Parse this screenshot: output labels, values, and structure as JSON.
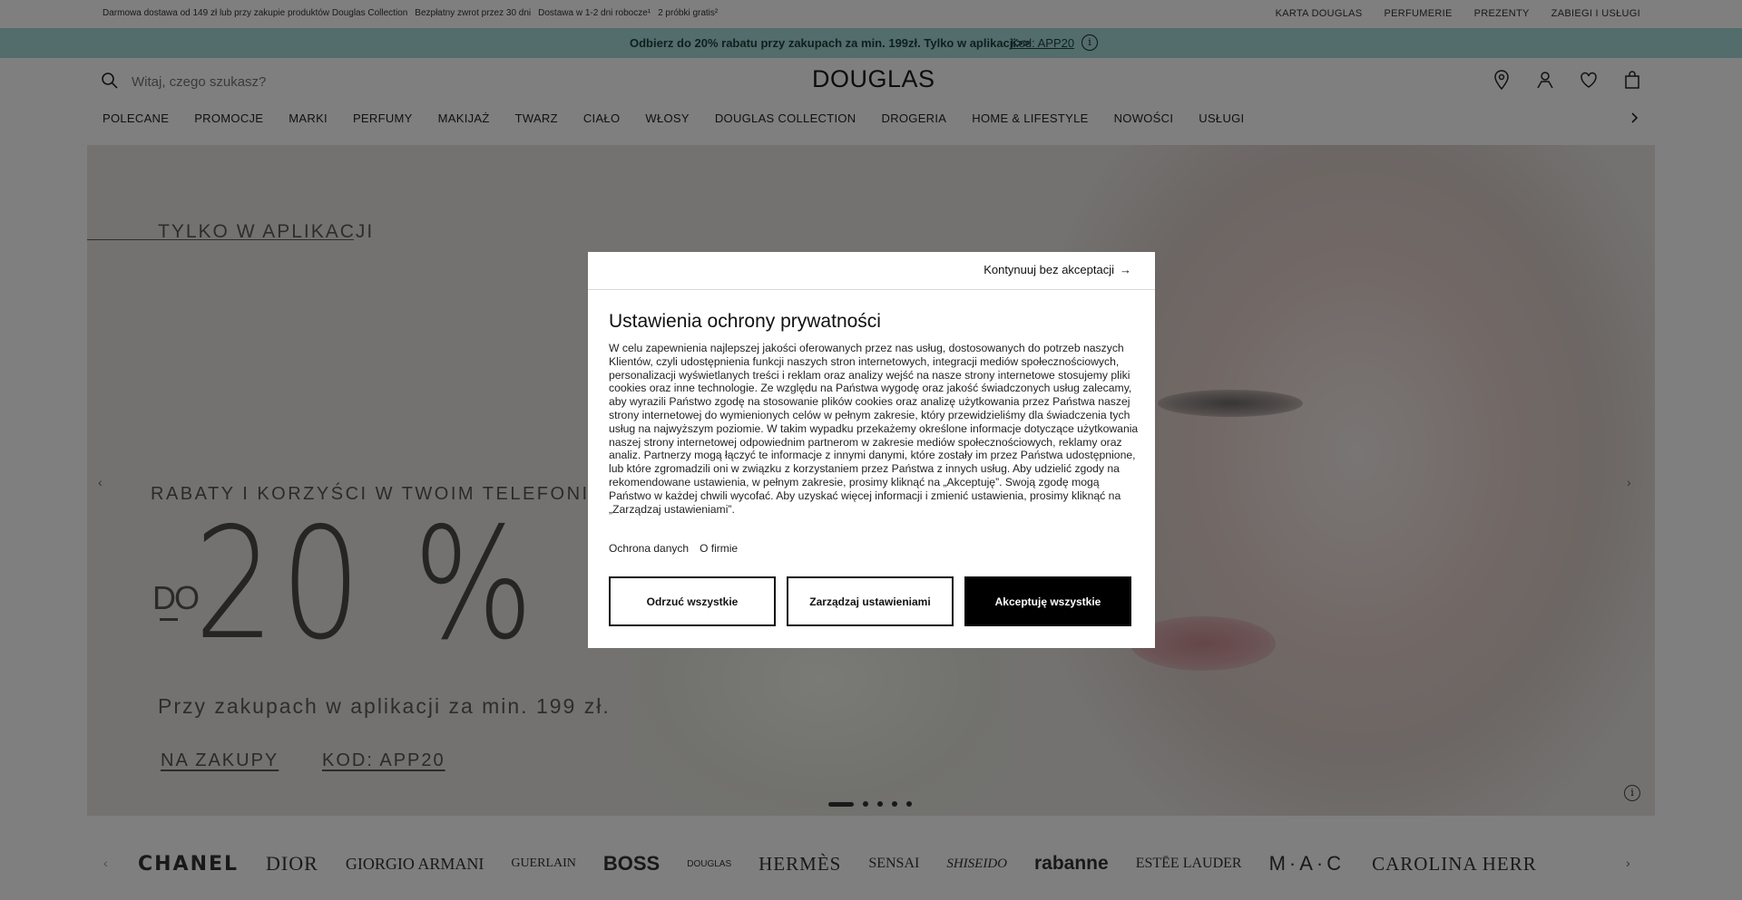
{
  "topbar": {
    "left": [
      "Darmowa dostawa od 149 zł lub przy zakupie produktów Douglas Collection",
      "Bezpłatny zwrot przez 30 dni",
      "Dostawa w 1-2 dni robocze¹",
      "2 próbki gratis²"
    ],
    "right": [
      "KARTA DOUGLAS",
      "PERFUMERIE",
      "PREZENTY",
      "ZABIEGI I USŁUGI"
    ]
  },
  "promo": {
    "message": "Odbierz do 20% rabatu przy zakupach za min. 199zł. Tylko w aplikacji>>",
    "code": "Kod: APP20",
    "info_glyph": "i"
  },
  "header": {
    "search_placeholder": "Witaj, czego szukasz?",
    "logo": "DOUGLAS",
    "icons": [
      "location-icon",
      "account-icon",
      "wishlist-icon",
      "bag-icon"
    ]
  },
  "nav": {
    "items": [
      "POLECANE",
      "PROMOCJE",
      "MARKI",
      "PERFUMY",
      "MAKIJAŻ",
      "TWARZ",
      "CIAŁO",
      "WŁOSY",
      "DOUGLAS COLLECTION",
      "DROGERIA",
      "HOME & LIFESTYLE",
      "NOWOŚCI",
      "USŁUGI"
    ]
  },
  "hero": {
    "only_app": "TYLKO W APLIKACJI",
    "tagline": "RABATY I KORZYŚCI W TWOIM TELEFONIE",
    "do": "DO",
    "percent": "20 %",
    "sub": "Przy zakupach w aplikacji za min. 199 zł.",
    "cta_shop": "NA ZAKUPY",
    "cta_code": "KOD: APP20",
    "arrow_left": "‹",
    "arrow_right": "›",
    "slides": 5,
    "active_slide": 1,
    "info_glyph": "i"
  },
  "brands": {
    "items": [
      "CHANEL",
      "DIOR",
      "GIORGIO ARMANI",
      "GUERLAIN",
      "BOSS",
      "DOUGLAS",
      "HERMÈS",
      "SENSAI",
      "SHISEIDO",
      "rabanne",
      "ESTĒE LAUDER",
      "M·A·C",
      "CAROLINA HERR"
    ],
    "arrow_left": "‹",
    "arrow_right": "›"
  },
  "modal": {
    "continue": "Kontynuuj bez akceptacji",
    "continue_arrow": "→",
    "title": "Ustawienia ochrony prywatności",
    "body": "W celu zapewnienia najlepszej jakości oferowanych przez nas usług, dostosowanych do potrzeb naszych Klientów, czyli udostępnienia funkcji naszych stron internetowych, integracji mediów społecznościowych, personalizacji wyświetlanych treści i reklam oraz analizy wejść na nasze strony internetowe stosujemy pliki cookies oraz inne technologie. Ze względu na Państwa wygodę oraz jakość świadczonych usług zalecamy, aby wyrazili Państwo zgodę na stosowanie plików cookies oraz analizę użytkowania przez Państwa naszej strony internetowej do wymienionych celów w pełnym zakresie, który przewidzieliśmy dla świadczenia tych usług na najwyższym poziomie. W takim wypadku przekażemy określone informacje dotyczące użytkowania naszej strony internetowej odpowiednim partnerom w zakresie mediów społecznościowych, reklamy oraz analiz. Partnerzy mogą łączyć te informacje z innymi danymi, które zostały im przez Państwa udostępnione, lub które zgromadzili oni w związku z korzystaniem przez Państwa z innych usług. Aby udzielić zgody na rekomendowane ustawienia, w pełnym zakresie, prosimy kliknąć na „Akceptuję”. Swoją zgodę mogą Państwo w każdej chwili wycofać. Aby uzyskać więcej informacji i zmienić ustawienia, prosimy kliknąć na „Zarządzaj ustawieniami”.",
    "link_privacy": "Ochrona danych",
    "link_about": "O firmie",
    "btn_reject": "Odrzuć wszystkie",
    "btn_manage": "Zarządzaj ustawieniami",
    "btn_accept": "Akceptuję wszystkie"
  }
}
